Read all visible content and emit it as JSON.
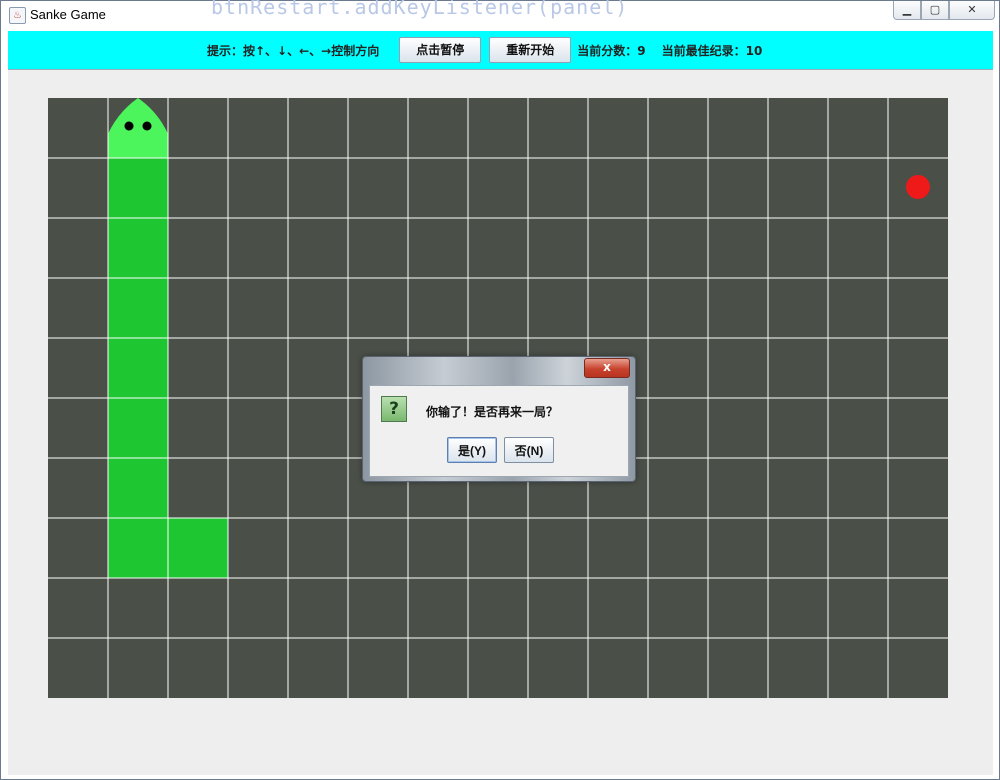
{
  "window": {
    "title": "Sanke Game",
    "background_code": "btnRestart.addKeyListener(panel)"
  },
  "toolbar": {
    "hint": "提示：按↑、↓、←、→控制方向",
    "pause_label": "点击暂停",
    "restart_label": "重新开始",
    "score_text": "当前分数：9",
    "best_text": "当前最佳纪录：10"
  },
  "board": {
    "cols": 15,
    "rows": 10,
    "cell_color": "#4a4f48",
    "grid_line_color": "#ffffff",
    "snake_color": "#1ec732",
    "snake_head_color": "#4cf55c",
    "food_color": "#ee1a1a",
    "snake_head": [
      1,
      0
    ],
    "snake_body": [
      [
        1,
        1
      ],
      [
        1,
        2
      ],
      [
        1,
        3
      ],
      [
        1,
        4
      ],
      [
        1,
        5
      ],
      [
        1,
        6
      ],
      [
        1,
        7
      ],
      [
        2,
        7
      ]
    ],
    "food": [
      14,
      1
    ]
  },
  "dialog": {
    "close_label": "x",
    "icon_label": "?",
    "message": "你输了！是否再来一局？",
    "yes_label": "是(Y)",
    "no_label": "否(N)"
  },
  "colors": {
    "toolbar_bg": "#00ffff",
    "content_bg": "#eeeeee"
  }
}
